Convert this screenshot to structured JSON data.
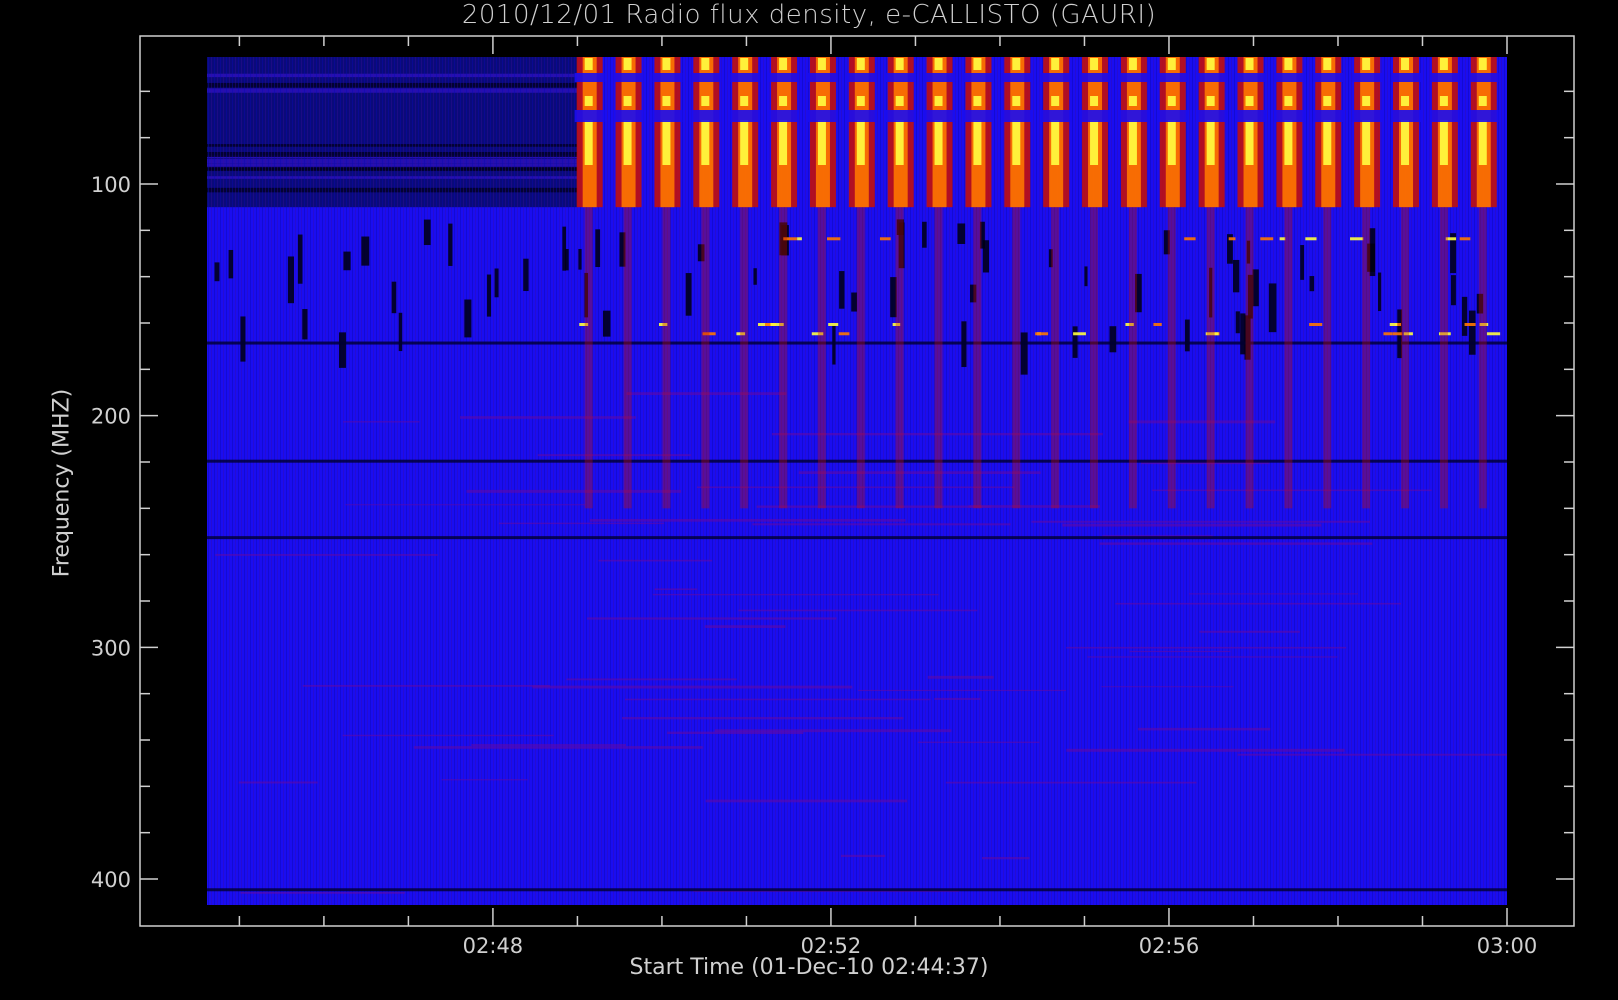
{
  "chart_data": {
    "type": "heatmap",
    "title": "2010/12/01  Radio flux density, e-CALLISTO (GAURI)",
    "xlabel": "Start Time (01-Dec-10 02:44:37)",
    "ylabel": "Frequency (MHZ)",
    "x_tick_labels": [
      "02:48",
      "02:52",
      "02:56",
      "03:00"
    ],
    "y_tick_labels": [
      "100",
      "200",
      "300",
      "400"
    ],
    "x_range": [
      "02:44:37",
      "03:00:00"
    ],
    "y_range_mhz": [
      45,
      410
    ],
    "y_axis_inverted": true,
    "colormap": {
      "low": "#000033",
      "background": "#1a0df0",
      "mid": "#cc1100",
      "high": "#ff7700",
      "peak": "#ffff40"
    },
    "features": {
      "burst_onset": "02:49:00",
      "burst_band_mhz": [
        45,
        110
      ],
      "burst_period_minutes": 0.46,
      "rfi_band_mhz": [
        115,
        175
      ],
      "quiet_dark_band_mhz": [
        45,
        110
      ],
      "persistent_line_mhz": 404
    }
  }
}
